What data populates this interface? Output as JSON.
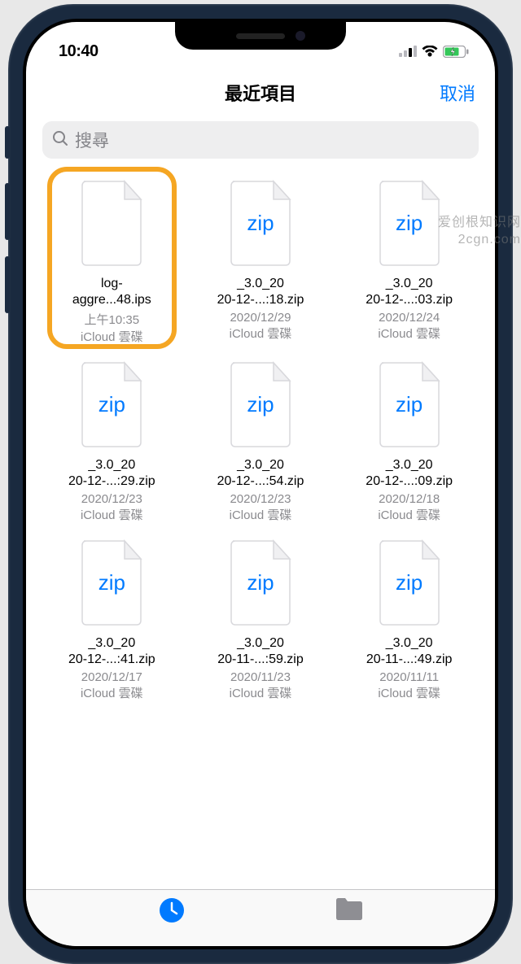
{
  "status": {
    "time": "10:40"
  },
  "nav": {
    "title": "最近項目",
    "cancel": "取消"
  },
  "search": {
    "placeholder": "搜尋"
  },
  "files": [
    {
      "icon_label": "",
      "name_l1": "log-",
      "name_l2": "aggre...48.ips",
      "time": "上午10:35",
      "location": "iCloud 雲碟",
      "highlighted": true
    },
    {
      "icon_label": "zip",
      "name_l1": "_3.0_20",
      "name_l2": "20-12-...:18.zip",
      "time": "2020/12/29",
      "location": "iCloud 雲碟",
      "highlighted": false
    },
    {
      "icon_label": "zip",
      "name_l1": "_3.0_20",
      "name_l2": "20-12-...:03.zip",
      "time": "2020/12/24",
      "location": "iCloud 雲碟",
      "highlighted": false
    },
    {
      "icon_label": "zip",
      "name_l1": "_3.0_20",
      "name_l2": "20-12-...:29.zip",
      "time": "2020/12/23",
      "location": "iCloud 雲碟",
      "highlighted": false
    },
    {
      "icon_label": "zip",
      "name_l1": "_3.0_20",
      "name_l2": "20-12-...:54.zip",
      "time": "2020/12/23",
      "location": "iCloud 雲碟",
      "highlighted": false
    },
    {
      "icon_label": "zip",
      "name_l1": "_3.0_20",
      "name_l2": "20-12-...:09.zip",
      "time": "2020/12/18",
      "location": "iCloud 雲碟",
      "highlighted": false
    },
    {
      "icon_label": "zip",
      "name_l1": "_3.0_20",
      "name_l2": "20-12-...:41.zip",
      "time": "2020/12/17",
      "location": "iCloud 雲碟",
      "highlighted": false
    },
    {
      "icon_label": "zip",
      "name_l1": "_3.0_20",
      "name_l2": "20-11-...:59.zip",
      "time": "2020/11/23",
      "location": "iCloud 雲碟",
      "highlighted": false
    },
    {
      "icon_label": "zip",
      "name_l1": "_3.0_20",
      "name_l2": "20-11-...:49.zip",
      "time": "2020/11/11",
      "location": "iCloud 雲碟",
      "highlighted": false
    }
  ],
  "watermark": {
    "l1": "爱创根知识网",
    "l2": "2cgn.com"
  }
}
